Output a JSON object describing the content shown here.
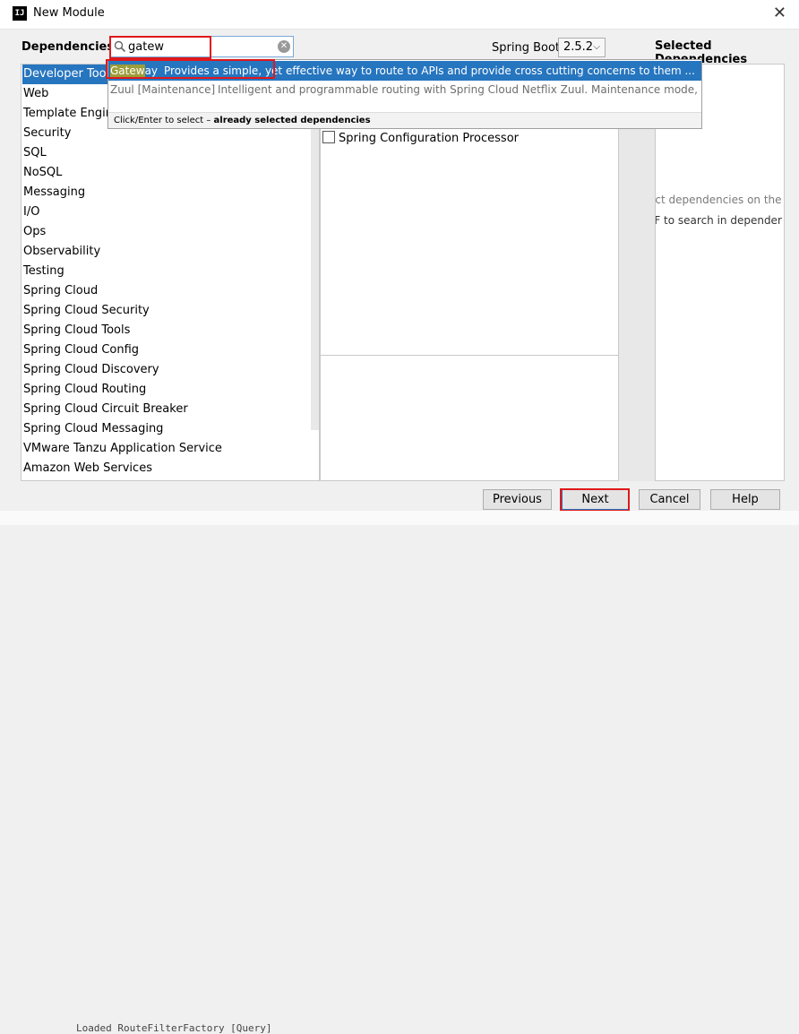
{
  "window": {
    "title": "New Module",
    "app_icon_text": "IJ"
  },
  "search": {
    "label": "Dependencies",
    "value": "gatew",
    "clear_icon": "clear-icon"
  },
  "spring_boot": {
    "label": "Spring Boot",
    "version": "2.5.2"
  },
  "selected_dependencies": {
    "label": "Selected Dependencies",
    "hint_line1": "ect dependencies on the",
    "hint_line2": "-F to search in depender"
  },
  "categories": [
    "Developer Tools",
    "Web",
    "Template Engines",
    "Security",
    "SQL",
    "NoSQL",
    "Messaging",
    "I/O",
    "Ops",
    "Observability",
    "Testing",
    "Spring Cloud",
    "Spring Cloud Security",
    "Spring Cloud Tools",
    "Spring Cloud Config",
    "Spring Cloud Discovery",
    "Spring Cloud Routing",
    "Spring Cloud Circuit Breaker",
    "Spring Cloud Messaging",
    "VMware Tanzu Application Service",
    "Amazon Web Services"
  ],
  "dependency_item": "Spring Configuration Processor",
  "popup": {
    "rows": [
      {
        "name_match": "Gatew",
        "name_rest": "ay",
        "description": "Provides a simple, yet effective way to route to APIs and provide cross cutting concerns to them ..."
      },
      {
        "name_match": "",
        "name_rest": "Zuul [Maintenance]",
        "description": "Intelligent and programmable routing with Spring Cloud Netflix Zuul. Maintenance mode, suggested ..."
      }
    ],
    "footer_prefix": "Click/Enter to select – ",
    "footer_bold": "already selected dependencies"
  },
  "buttons": {
    "previous": "Previous",
    "next": "Next",
    "cancel": "Cancel",
    "help": "Help"
  },
  "background_text": "Loaded RouteFilterFactory [Query]",
  "colors": {
    "selection": "#2675bf",
    "highlight_box": "#e0181b"
  }
}
